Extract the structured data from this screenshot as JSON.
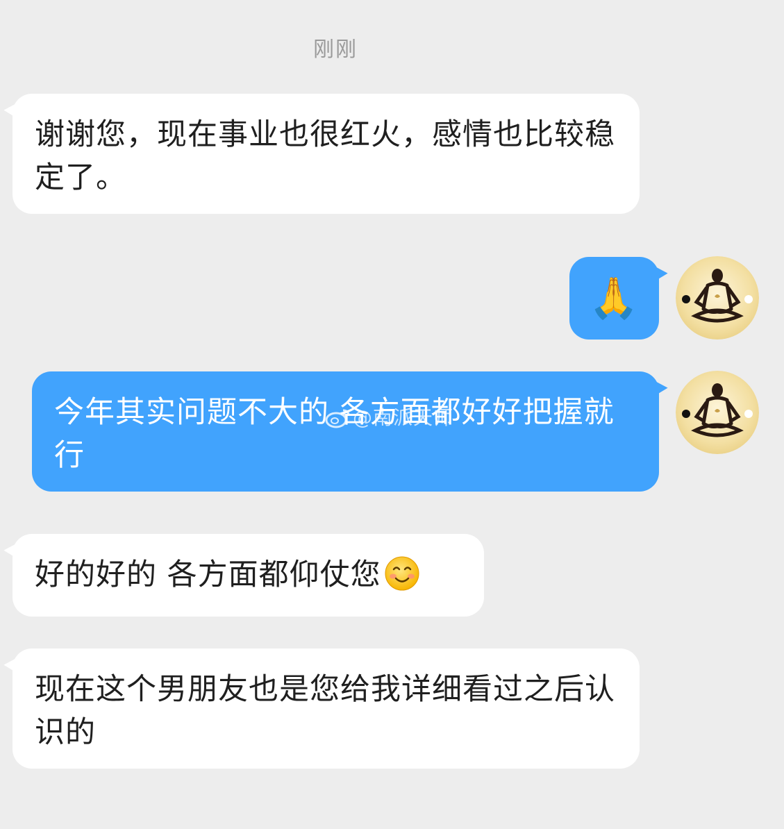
{
  "timestamp": "刚刚",
  "messages": [
    {
      "id": "msg1",
      "side": "incoming",
      "text": "谢谢您，现在事业也很红火，感情也比较稳定了。"
    },
    {
      "id": "msg2",
      "side": "outgoing",
      "emoji": "🙏"
    },
    {
      "id": "msg3",
      "side": "outgoing",
      "text": "今年其实问题不大的 各方面都好好把握就行"
    },
    {
      "id": "msg4",
      "side": "incoming",
      "text": "好的好的 各方面都仰仗您"
    },
    {
      "id": "msg5",
      "side": "incoming",
      "text": "现在这个男朋友也是您给我详细看过之后认识的"
    }
  ],
  "watermark": "@南派天师",
  "icons": {
    "smiley": "smiling-face-icon",
    "pray": "folded-hands-emoji",
    "avatar": "meditation-avatar-icon",
    "weibo": "weibo-logo-icon"
  },
  "colors": {
    "background": "#ededed",
    "incoming_bubble": "#ffffff",
    "outgoing_bubble": "#41a3fd",
    "timestamp_text": "#9a9a9a",
    "avatar_bg": "#f2deA0"
  }
}
